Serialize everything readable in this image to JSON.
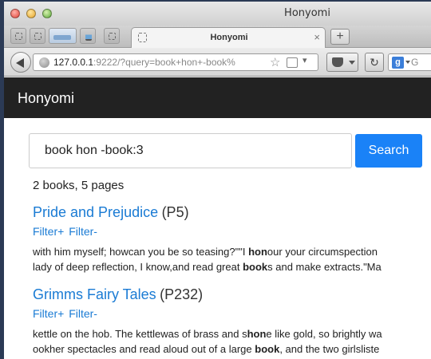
{
  "window": {
    "title": "Honyomi"
  },
  "tab": {
    "label": "Honyomi",
    "close": "×",
    "new_tab": "+"
  },
  "navbar": {
    "url_host": "127.0.0.1",
    "url_rest": ":9222/?query=book+hon+-book%",
    "reload_glyph": "↻",
    "search_engine_letter": "g",
    "search_placeholder": "G"
  },
  "app": {
    "brand": "Honyomi"
  },
  "search": {
    "query": "book hon -book:3",
    "button": "Search"
  },
  "summary": "2 books, 5 pages",
  "results": [
    {
      "title": "Pride and Prejudice",
      "page": "(P5)",
      "filter_plus": "Filter+",
      "filter_minus": "Filter-",
      "line1": [
        {
          "t": "with him myself; howcan you be so teasing?\"\"I ",
          "b": false
        },
        {
          "t": "hon",
          "b": true
        },
        {
          "t": "our your circumspection",
          "b": false
        }
      ],
      "line2": [
        {
          "t": "lady of deep reflection, I know,and read great ",
          "b": false
        },
        {
          "t": "book",
          "b": true
        },
        {
          "t": "s and make extracts.\"Ma",
          "b": false
        }
      ]
    },
    {
      "title": "Grimms Fairy Tales",
      "page": "(P232)",
      "filter_plus": "Filter+",
      "filter_minus": "Filter-",
      "line1": [
        {
          "t": "kettle on the hob. The kettlewas of brass and s",
          "b": false
        },
        {
          "t": "hon",
          "b": true
        },
        {
          "t": "e like gold, so brightly wa",
          "b": false
        }
      ],
      "line2": [
        {
          "t": "ookher spectacles and read aloud out of a large ",
          "b": false
        },
        {
          "t": "book",
          "b": true
        },
        {
          "t": ", and the two girlsliste",
          "b": false
        }
      ]
    }
  ],
  "colors": {
    "link": "#1a7bd4",
    "button": "#1a82f7",
    "header": "#222222"
  }
}
